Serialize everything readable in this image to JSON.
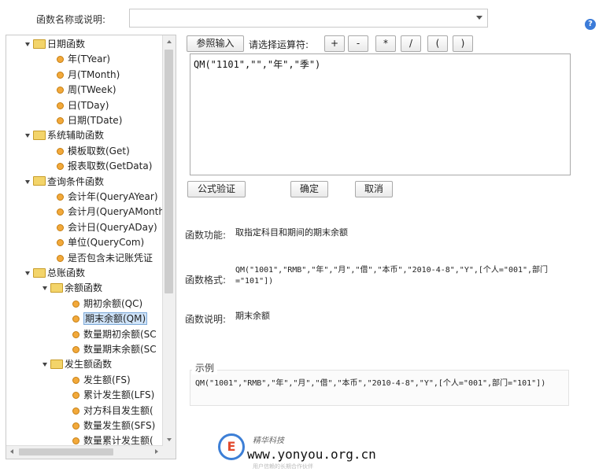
{
  "header": {
    "function_label": "函数名称或说明:",
    "function_select_value": ""
  },
  "icons": {
    "help": "help-circle-icon",
    "dropdown": "chevron-down-icon",
    "folder": "folder-icon",
    "leaf": "bullet-icon"
  },
  "tree": [
    {
      "level": 1,
      "type": "folder",
      "label": "日期函数"
    },
    {
      "level": 2,
      "type": "leaf",
      "label": "年(TYear)"
    },
    {
      "level": 2,
      "type": "leaf",
      "label": "月(TMonth)"
    },
    {
      "level": 2,
      "type": "leaf",
      "label": "周(TWeek)"
    },
    {
      "level": 2,
      "type": "leaf",
      "label": "日(TDay)"
    },
    {
      "level": 2,
      "type": "leaf",
      "label": "日期(TDate)"
    },
    {
      "level": 1,
      "type": "folder",
      "label": "系统辅助函数"
    },
    {
      "level": 2,
      "type": "leaf",
      "label": "模板取数(Get)"
    },
    {
      "level": 2,
      "type": "leaf",
      "label": "报表取数(GetData)"
    },
    {
      "level": 1,
      "type": "folder",
      "label": "查询条件函数"
    },
    {
      "level": 2,
      "type": "leaf",
      "label": "会计年(QueryAYear)"
    },
    {
      "level": 2,
      "type": "leaf",
      "label": "会计月(QueryAMonth)"
    },
    {
      "level": 2,
      "type": "leaf",
      "label": "会计日(QueryADay)"
    },
    {
      "level": 2,
      "type": "leaf",
      "label": "单位(QueryCom)"
    },
    {
      "level": 2,
      "type": "leaf",
      "label": "是否包含未记账凭证"
    },
    {
      "level": 1,
      "type": "folder",
      "label": "总账函数"
    },
    {
      "level": 2,
      "type": "folder",
      "label": "余额函数"
    },
    {
      "level": 3,
      "type": "leaf",
      "label": "期初余额(QC)"
    },
    {
      "level": 3,
      "type": "leaf",
      "label": "期末余额(QM)",
      "selected": true
    },
    {
      "level": 3,
      "type": "leaf",
      "label": "数量期初余额(SC"
    },
    {
      "level": 3,
      "type": "leaf",
      "label": "数量期末余额(SC"
    },
    {
      "level": 2,
      "type": "folder",
      "label": "发生额函数"
    },
    {
      "level": 3,
      "type": "leaf",
      "label": "发生额(FS)"
    },
    {
      "level": 3,
      "type": "leaf",
      "label": "累计发生额(LFS)"
    },
    {
      "level": 3,
      "type": "leaf",
      "label": "对方科目发生额("
    },
    {
      "level": 3,
      "type": "leaf",
      "label": "数量发生额(SFS)"
    },
    {
      "level": 3,
      "type": "leaf",
      "label": "数量累计发生额("
    }
  ],
  "toolbar": {
    "reference_input": "参照输入",
    "operator_prompt": "请选择运算符:",
    "operators": [
      "+",
      "-",
      "*",
      "/",
      "(",
      ")"
    ]
  },
  "editor": {
    "formula": "QM(\"1101\",\"\",\"年\",\"季\")"
  },
  "actions": {
    "verify": "公式验证",
    "ok": "确定",
    "cancel": "取消"
  },
  "info": {
    "function_label": "函数功能:",
    "function_value": "取指定科目和期间的期末余额",
    "format_label": "函数格式:",
    "format_value": "QM(\"1001\",\"RMB\",\"年\",\"月\",\"借\",\"本币\",\"2010-4-8\",\"Y\",[个人=\"001\",部门=\"101\"])",
    "desc_label": "函数说明:",
    "desc_value": "期末余额"
  },
  "example": {
    "title": "示例",
    "text": "QM(\"1001\",\"RMB\",\"年\",\"月\",\"借\",\"本币\",\"2010-4-8\",\"Y\",[个人=\"001\",部门=\"101\"])"
  },
  "watermark": {
    "logo_text": "E",
    "brand": "精华科技",
    "url": "www.yonyou.org.cn",
    "tagline": "用户信赖的长期合作伙伴"
  }
}
